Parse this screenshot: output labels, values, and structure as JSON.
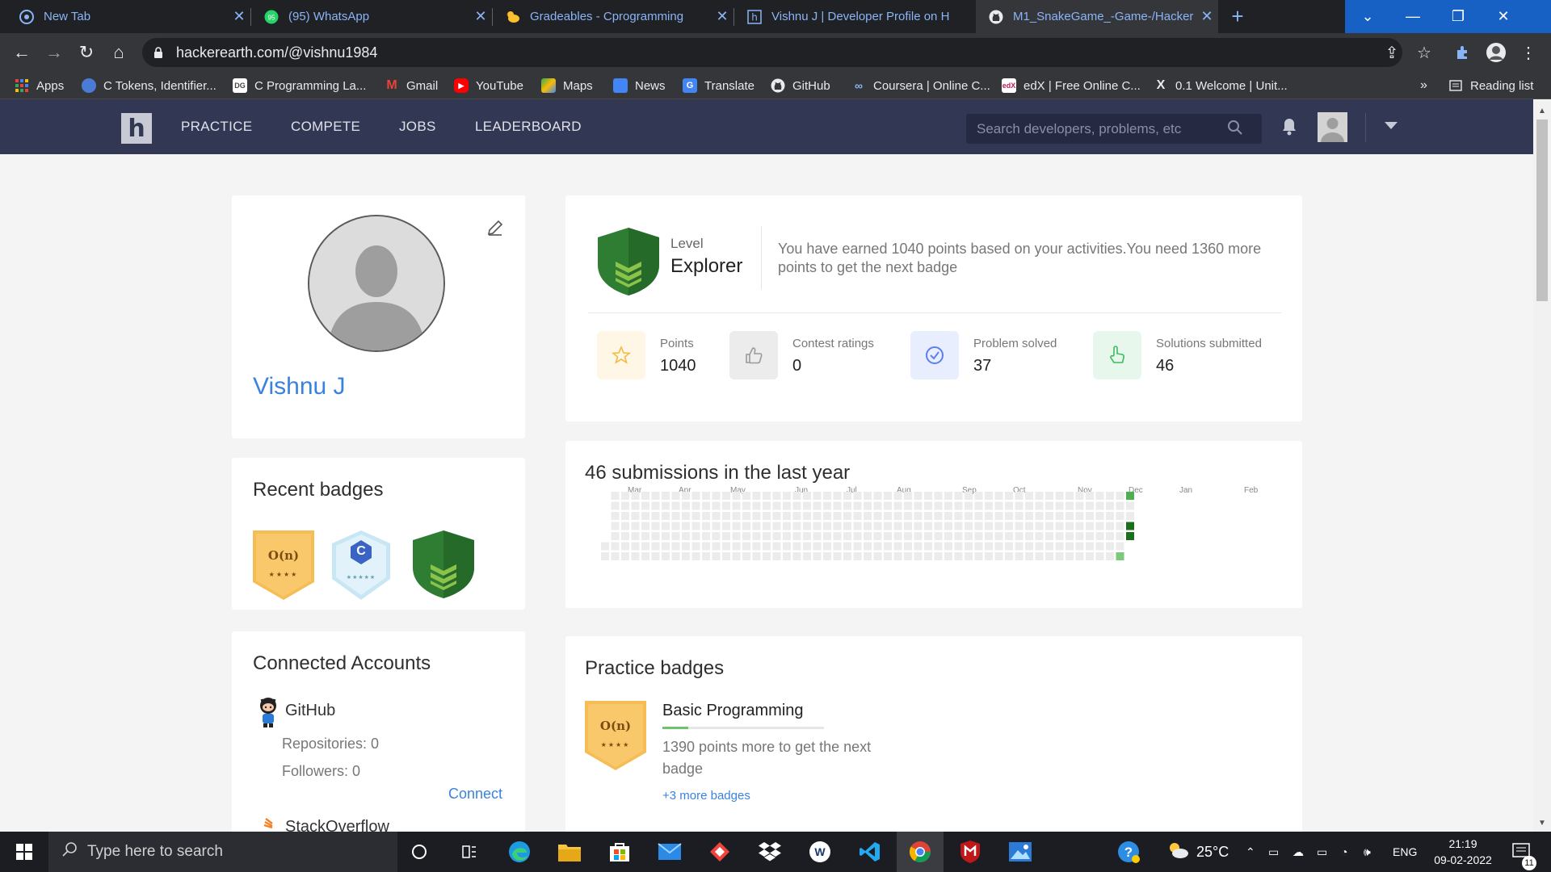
{
  "browser": {
    "tabs": [
      {
        "title": "New Tab",
        "icon": "chrome-icon"
      },
      {
        "title": "(95) WhatsApp",
        "icon": "whatsapp-icon"
      },
      {
        "title": "Gradeables - Cprogramming",
        "icon": "duck-icon"
      },
      {
        "title": "Vishnu J | Developer Profile on H",
        "icon": "hackerearth-icon"
      },
      {
        "title": "M1_SnakeGame_-Game-/Hacker",
        "icon": "github-icon"
      }
    ],
    "url": "hackerearth.com/@vishnu1984",
    "bookmarks": [
      {
        "label": "Apps",
        "icon": "apps-grid-icon"
      },
      {
        "label": "C Tokens, Identifier...",
        "icon": "globe-icon"
      },
      {
        "label": "C Programming La...",
        "icon": "dg-icon"
      },
      {
        "label": "Gmail",
        "icon": "gmail-icon"
      },
      {
        "label": "YouTube",
        "icon": "youtube-icon"
      },
      {
        "label": "Maps",
        "icon": "maps-icon"
      },
      {
        "label": "News",
        "icon": "news-icon"
      },
      {
        "label": "Translate",
        "icon": "translate-icon"
      },
      {
        "label": "GitHub",
        "icon": "github-icon"
      },
      {
        "label": "Coursera | Online C...",
        "icon": "coursera-icon"
      },
      {
        "label": "edX | Free Online C...",
        "icon": "edx-icon"
      },
      {
        "label": "0.1 Welcome | Unit...",
        "icon": "x-icon"
      }
    ],
    "overflow": "»",
    "reading_list": "Reading list"
  },
  "site": {
    "logo": "h",
    "nav": [
      "PRACTICE",
      "COMPETE",
      "JOBS",
      "LEADERBOARD"
    ],
    "search_placeholder": "Search developers, problems, etc"
  },
  "profile": {
    "name": "Vishnu J"
  },
  "level": {
    "label": "Level",
    "name": "Explorer",
    "message": "You have earned 1040 points based on your activities.You need 1360 more points to get the next badge",
    "stats": [
      {
        "label": "Points",
        "value": "1040",
        "icon": "star-icon",
        "bg": "#fff7e6",
        "fg": "#f5b942"
      },
      {
        "label": "Contest ratings",
        "value": "0",
        "icon": "thumbs-up-icon",
        "bg": "#ececec",
        "fg": "#9a9a9a"
      },
      {
        "label": "Problem solved",
        "value": "37",
        "icon": "check-circle-icon",
        "bg": "#e9eefe",
        "fg": "#5b7ff0"
      },
      {
        "label": "Solutions submitted",
        "value": "46",
        "icon": "hand-pointer-icon",
        "bg": "#e8f7ec",
        "fg": "#3cbb5d"
      }
    ]
  },
  "badges": {
    "title": "Recent badges",
    "items": [
      {
        "text": "O(n)",
        "stars": "★★★★",
        "color": "#f6bd57"
      },
      {
        "text": "C",
        "stars": "★★★★★",
        "color": "#d8eef8"
      },
      {
        "text": "",
        "stars": "",
        "color": "#2e7d32"
      }
    ]
  },
  "submissions": {
    "title": "46 submissions in the last year",
    "months": [
      "Mar",
      "Apr",
      "May",
      "Jun",
      "Jul",
      "Aug",
      "Sep",
      "Oct",
      "Nov",
      "Dec",
      "Jan",
      "Feb"
    ]
  },
  "connected": {
    "title": "Connected Accounts",
    "github": {
      "name": "GitHub",
      "repos": "Repositories: 0",
      "followers": "Followers: 0",
      "connect": "Connect"
    },
    "next": "StackOverflow"
  },
  "practice": {
    "title": "Practice badges",
    "badge_name": "Basic Programming",
    "badge_text": "O(n)",
    "badge_stars": "★★★★",
    "progress": 0.16,
    "message": "1390 points more to get the next badge",
    "more": "+3 more badges"
  },
  "taskbar": {
    "search_placeholder": "Type here to search",
    "weather": "25°C",
    "lang": "ENG",
    "time": "21:19",
    "date": "09-02-2022",
    "notifications": "11"
  },
  "colors": {
    "site_header": "#323754",
    "accent_blue": "#3a82e0",
    "explorer_green": "#2e7d32"
  }
}
